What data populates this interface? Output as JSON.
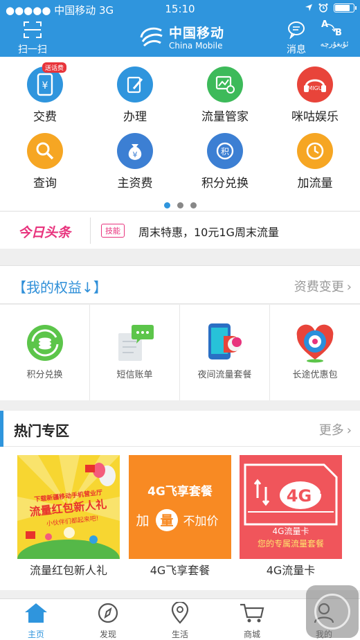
{
  "status_bar": {
    "carrier": "●●●●● 中国移动  3G",
    "time": "15:10"
  },
  "header": {
    "scan_label": "扫一扫",
    "logo_cn": "中国移动",
    "logo_en": "China Mobile",
    "msg_label": "消息",
    "lang_label": "ئۇيغۇرچە",
    "lang_glyph_a": "A",
    "lang_glyph_b": "B"
  },
  "grid": [
    {
      "label": "交费",
      "icon": "phone-yen-icon",
      "color": "#2f95dd",
      "badge": "送话费"
    },
    {
      "label": "办理",
      "icon": "edit-icon",
      "color": "#2f95dd"
    },
    {
      "label": "流量管家",
      "icon": "traffic-manager-icon",
      "color": "#3dba5a"
    },
    {
      "label": "咪咕娱乐",
      "icon": "migu-icon",
      "color": "#e8443a",
      "icon_text": "MIGU"
    },
    {
      "label": "查询",
      "icon": "search-icon",
      "color": "#f6a623"
    },
    {
      "label": "主资费",
      "icon": "money-bag-icon",
      "color": "#3c7fd3",
      "icon_text": "¥"
    },
    {
      "label": "积分兑换",
      "icon": "points-icon",
      "color": "#3c7fd3",
      "icon_text": "积"
    },
    {
      "label": "加流量",
      "icon": "add-traffic-icon",
      "color": "#f6a623"
    }
  ],
  "news": {
    "brand": "今日头条",
    "tag": "技能",
    "text": "周末特惠，10元1G周末流量"
  },
  "rights": {
    "title": "【我的权益↓】",
    "more": "资费变更",
    "items": [
      {
        "label": "积分兑换",
        "icon": "points-exchange-icon"
      },
      {
        "label": "短信账单",
        "icon": "sms-bill-icon"
      },
      {
        "label": "夜间流量套餐",
        "icon": "night-traffic-icon"
      },
      {
        "label": "长途优惠包",
        "icon": "long-distance-icon"
      }
    ]
  },
  "hot": {
    "title": "热门专区",
    "more": "更多",
    "cards": [
      {
        "label": "流量红包新人礼",
        "line1": "下载新疆移动手机营业厅",
        "line2": "流量红包新人礼",
        "line3": "小伙伴们都起来吧!"
      },
      {
        "label": "4G飞享套餐",
        "line1": "4G飞享套餐",
        "line2a": "加",
        "line2b": "量",
        "line2c": "不加价"
      },
      {
        "label": "4G流量卡",
        "line1": "4G",
        "line2": "4G流量卡",
        "line3": "您的专属流量套餐"
      }
    ]
  },
  "tabs": [
    {
      "label": "主页",
      "icon": "home-icon",
      "active": true
    },
    {
      "label": "发现",
      "icon": "compass-icon"
    },
    {
      "label": "生活",
      "icon": "location-pin-icon"
    },
    {
      "label": "商城",
      "icon": "cart-icon"
    },
    {
      "label": "我的",
      "icon": "user-icon"
    }
  ],
  "colors": {
    "brand": "#2f95dd",
    "news_accent": "#e8337d"
  }
}
